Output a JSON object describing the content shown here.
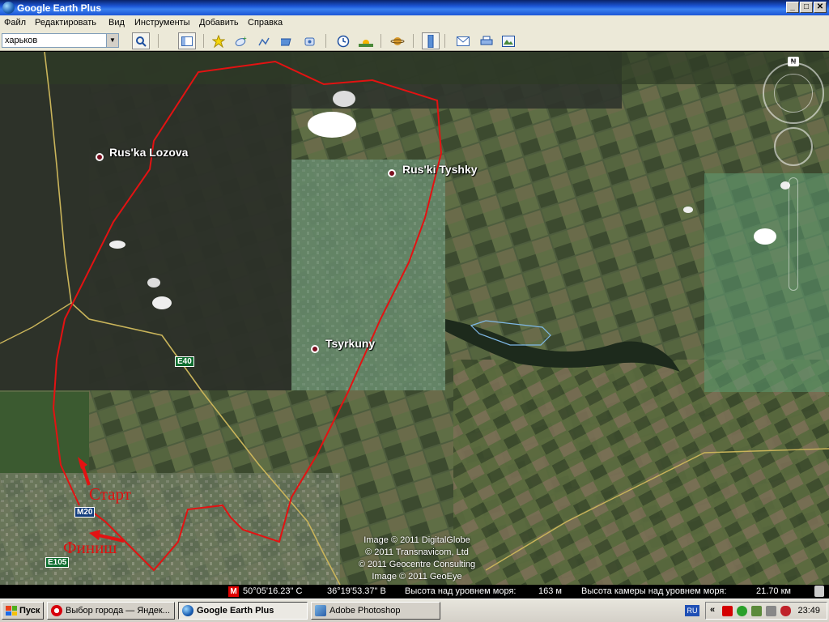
{
  "window": {
    "title": "Google Earth Plus",
    "buttons": [
      "_",
      "□",
      "✕"
    ]
  },
  "menu": [
    "Файл",
    "Редактировать",
    "Вид",
    "Инструменты",
    "Добавить",
    "Справка"
  ],
  "search": {
    "value": "харьков"
  },
  "toolbar_icons": [
    "search-icon",
    "sidebar-icon",
    "placemark-icon",
    "polygon-icon",
    "path-icon",
    "overlay-icon",
    "record-tour-icon",
    "historical-imagery-icon",
    "sunlight-icon",
    "planet-icon",
    "ruler-icon",
    "email-icon",
    "print-icon",
    "view-in-maps-icon"
  ],
  "places": [
    {
      "name": "Rus'ka Lozova"
    },
    {
      "name": "Rus'ki Tyshky"
    },
    {
      "name": "Tsyrkuny"
    }
  ],
  "roads": {
    "e40": "E40",
    "m20": "M20",
    "e105": "E105"
  },
  "annotations": {
    "start": "Старт",
    "finish": "Финиш"
  },
  "credits": [
    "Image © 2011 DigitalGlobe",
    "© 2011 Transnavicom, Ltd",
    "© 2011 Geocentre Consulting",
    "Image © 2011 GeoEye"
  ],
  "status": {
    "lat": "50°05'16.23\" С",
    "lon": "36°19'53.37\" В",
    "elev_label": "Высота над уровнем моря:",
    "elev_value": "163 м",
    "eye_label": "Высота камеры над уровнем моря:",
    "eye_value": "21.70 км"
  },
  "compass": {
    "north": "N"
  },
  "taskbar": {
    "start": "Пуск",
    "tasks": [
      "Выбор города — Яндек...",
      "Google Earth Plus",
      "Adobe Photoshop"
    ],
    "lang": "RU",
    "tray_arrow": "«",
    "time": "23:49"
  },
  "colors": {
    "route": "#e31212",
    "road": "#c9b45a",
    "title_bar": "#0a246a"
  }
}
